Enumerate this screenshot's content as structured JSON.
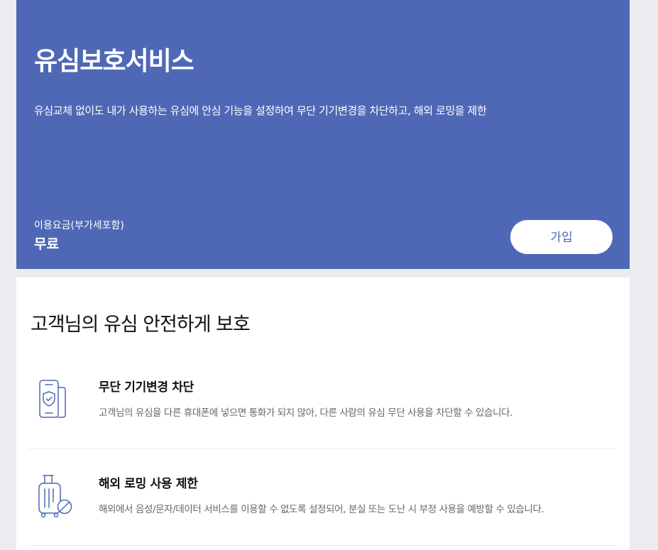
{
  "colors": {
    "hero_background": "#4f68b6",
    "icon_stroke": "#4f68b6",
    "page_background": "#ebecef"
  },
  "hero": {
    "title": "유심보호서비스",
    "description": "유심교체 없이도 내가 사용하는 유심에 안심 기능을 설정하여 무단 기기변경을 차단하고, 해외 로밍을 제한",
    "fee_label": "이용요금(부가세포함)",
    "fee_value": "무료",
    "join_label": "가입"
  },
  "content": {
    "section_title": "고객님의 유심 안전하게 보호",
    "features": [
      {
        "icon": "phone-shield-icon",
        "title": "무단 기기변경 차단",
        "description": "고객님의 유심을 다른 휴대폰에 넣으면 통화가 되지 않아, 다른 사람의 유심 무단 사용을 차단할 수 있습니다."
      },
      {
        "icon": "luggage-blocked-icon",
        "title": "해외 로밍 사용 제한",
        "description": "해외에서 음성/문자/데이터 서비스를 이용할 수 없도록 설정되어, 분실 또는 도난 시 부정 사용을 예방할 수 있습니다."
      }
    ]
  }
}
